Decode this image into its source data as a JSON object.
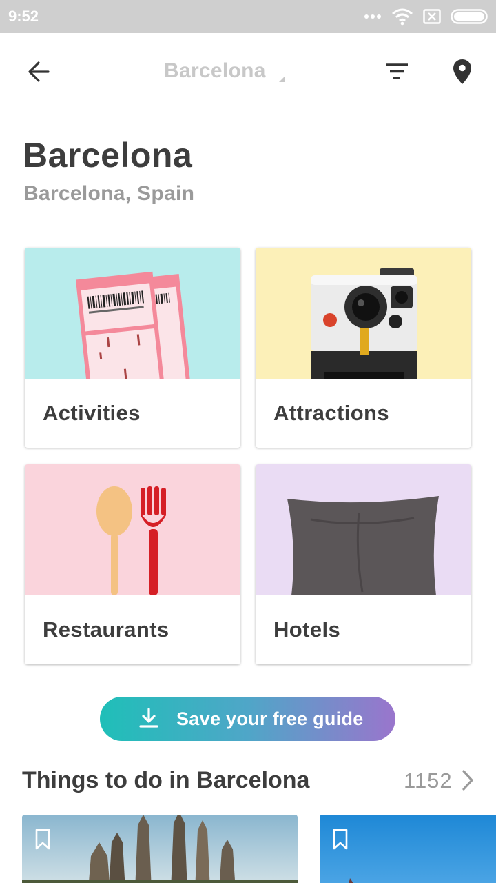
{
  "status_bar": {
    "time": "9:52",
    "icons": [
      "more-dots-icon",
      "wifi-icon",
      "sim-card-icon",
      "battery-icon"
    ]
  },
  "app_bar": {
    "back_icon": "arrow-left-icon",
    "title": "Barcelona",
    "filter_icon": "filter-icon",
    "map_icon": "map-pin-icon"
  },
  "header": {
    "title": "Barcelona",
    "subtitle": "Barcelona, Spain"
  },
  "categories": [
    {
      "label": "Activities",
      "image": "tickets",
      "bg_color": "#b8ecec"
    },
    {
      "label": "Attractions",
      "image": "instant-camera",
      "bg_color": "#fcf0b8"
    },
    {
      "label": "Restaurants",
      "image": "spoon-and-fork",
      "bg_color": "#fad4dc"
    },
    {
      "label": "Hotels",
      "image": "pillow",
      "bg_color": "#eadcf4"
    }
  ],
  "save_guide": {
    "label": "Save your free guide",
    "icon": "download-icon",
    "gradient": [
      "#1fbfb8",
      "#9a75cc"
    ]
  },
  "things_to_do": {
    "title": "Things to do in Barcelona",
    "count": "1152",
    "items": [
      {
        "image": "sagrada-familia",
        "bookmark_icon": "bookmark-icon"
      },
      {
        "image": "city-sky",
        "bookmark_icon": "bookmark-icon"
      }
    ]
  }
}
